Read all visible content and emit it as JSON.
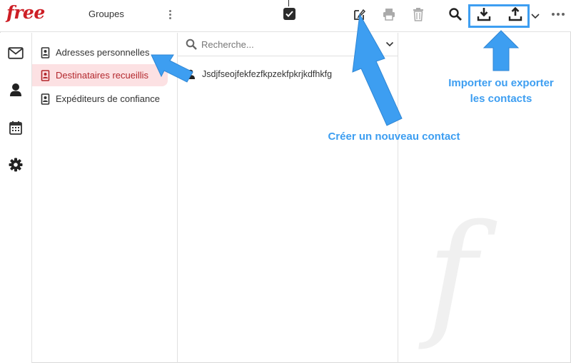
{
  "app": {
    "logo_text": "free",
    "groups_label": "Groupes"
  },
  "toolbar": {
    "icons": [
      "select-all-icon",
      "compose-icon",
      "print-icon",
      "trash-icon",
      "search-icon",
      "import-icon",
      "export-icon",
      "chevron-down-icon",
      "more-icon"
    ]
  },
  "rail": {
    "items": [
      {
        "icon": "mail-icon"
      },
      {
        "icon": "contacts-icon"
      },
      {
        "icon": "calendar-icon"
      },
      {
        "icon": "settings-icon"
      }
    ]
  },
  "address_books": [
    {
      "label": "Adresses personnelles",
      "active": false
    },
    {
      "label": "Destinataires recueillis",
      "active": true
    },
    {
      "label": "Expéditeurs de confiance",
      "active": false
    }
  ],
  "search": {
    "placeholder": "Recherche..."
  },
  "contacts": [
    {
      "name": "Jsdjfseojfekfezfkpzekfpkrjkdfhkfg"
    }
  ],
  "annotations": {
    "create_contact": "Créer un nouveau contact",
    "import_export_line1": "Importer ou exporter",
    "import_export_line2": "les contacts"
  },
  "colors": {
    "brand": "#cd1e25",
    "active_bg": "#fce1e3",
    "active_text": "#b3282d",
    "annotation": "#3d9ef1"
  }
}
